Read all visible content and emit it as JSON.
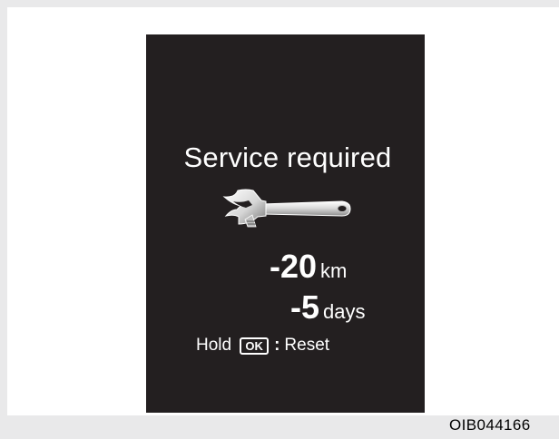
{
  "display": {
    "title": "Service required",
    "icon": "wrench-icon",
    "distance": {
      "value": "-20",
      "unit": "km"
    },
    "time": {
      "value": "-5",
      "unit": "days"
    },
    "reset": {
      "prefix": "Hold",
      "button": "OK",
      "colon": ":",
      "action": "Reset"
    }
  },
  "figure_code": "OIB044166",
  "colors": {
    "background": "#e9e9ea",
    "panel": "#ffffff",
    "display": "#231f20",
    "text": "#ffffff"
  }
}
